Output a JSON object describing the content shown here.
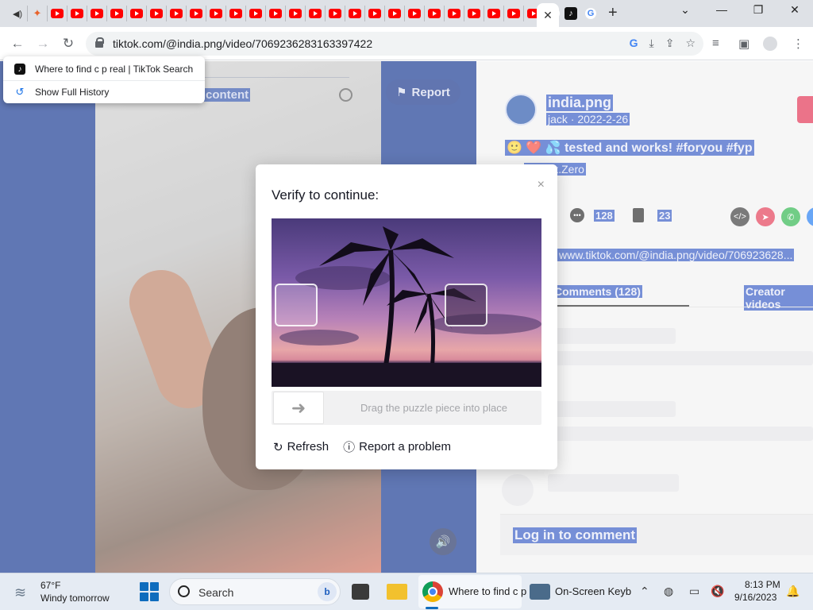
{
  "browser": {
    "url": "tiktok.com/@india.png/video/7069236283163397422",
    "history_menu": [
      {
        "label": "Where to find c p real | TikTok Search"
      },
      {
        "label": "Show Full History"
      }
    ],
    "window_controls": {
      "minimize": "—",
      "maximize": "❐",
      "close": "✕"
    },
    "active_tab_close": "✕",
    "new_tab": "+"
  },
  "page": {
    "report_label": "Report",
    "content_label": "content",
    "username": "india.png",
    "user_sub": "jack · 2022-2-26",
    "caption": "🙂 ❤️ 💦 tested and works! #foryou #fyp",
    "music": "ey - Jx.Zero",
    "comments_count": "128",
    "saves_count": "23",
    "link": "www.tiktok.com/@india.png/video/706923628...",
    "tab_comments": "Comments (128)",
    "tab_creator": "Creator videos",
    "login_prompt": "Log in to comment"
  },
  "captcha": {
    "title": "Verify to continue:",
    "close": "×",
    "slider_hint": "Drag the puzzle piece into place",
    "refresh_label": "Refresh",
    "report_label": "Report a problem"
  },
  "taskbar": {
    "weather_temp": "67°F",
    "weather_desc": "Windy tomorrow",
    "search_label": "Search",
    "chrome_label": "Where to find c p",
    "keyboard_label": "On-Screen Keyb",
    "time": "8:13 PM",
    "date": "9/16/2023"
  }
}
